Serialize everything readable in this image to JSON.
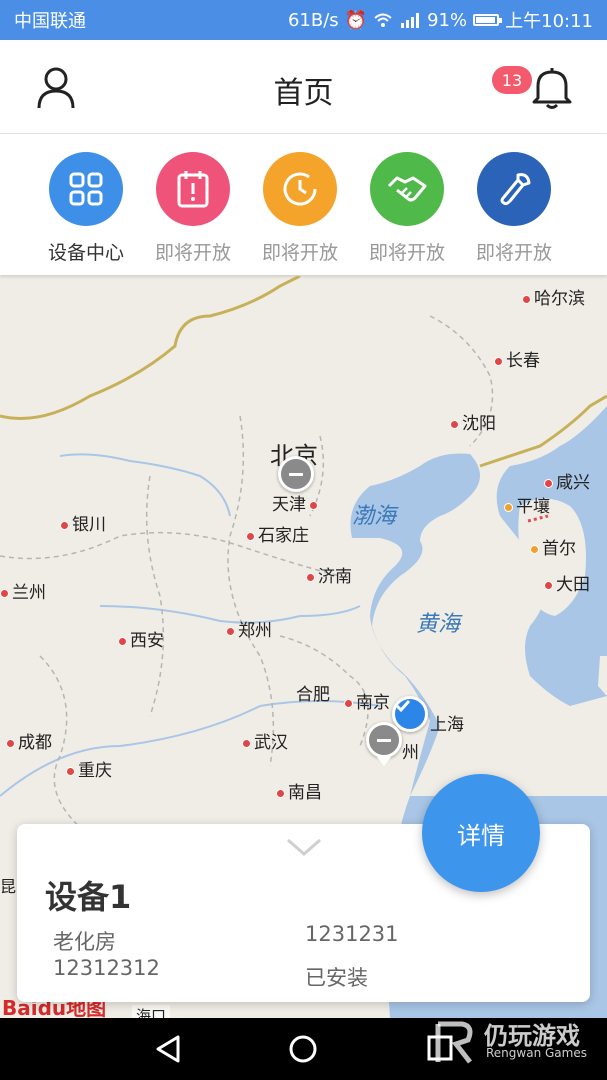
{
  "status_bar": {
    "carrier": "中国联通",
    "net_speed": "61B/s",
    "battery": "91%",
    "time": "上午10:11"
  },
  "header": {
    "title": "首页",
    "notification_count": "13",
    "left_icon": "user-icon",
    "right_icon": "bell-icon"
  },
  "quick_actions": [
    {
      "label": "设备中心",
      "icon": "grid-icon",
      "color": "#3d8fe8",
      "label_color": "#333333"
    },
    {
      "label": "即将开放",
      "icon": "clipboard-alert-icon",
      "color": "#f0537a",
      "label_color": "#999999"
    },
    {
      "label": "即将开放",
      "icon": "clock-icon",
      "color": "#f4a42a",
      "label_color": "#999999"
    },
    {
      "label": "即将开放",
      "icon": "handshake-icon",
      "color": "#4fb94a",
      "label_color": "#999999"
    },
    {
      "label": "即将开放",
      "icon": "wrench-icon",
      "color": "#2a63b8",
      "label_color": "#999999"
    }
  ],
  "map": {
    "cities": {
      "harbin": "哈尔滨",
      "changchun": "长春",
      "shenyang": "沈阳",
      "beijing": "北京",
      "tianjin": "天津",
      "shijiazhuang": "石家庄",
      "jinan": "济南",
      "yinchuan": "银川",
      "lanzhou": "兰州",
      "xian": "西安",
      "zhengzhou": "郑州",
      "hefei": "合肥",
      "nanjing": "南京",
      "shanghai": "上海",
      "hangzhou": "州",
      "chengdu": "成都",
      "chongqing": "重庆",
      "wuhan": "武汉",
      "nanchang": "南昌",
      "xianxing": "咸兴",
      "pyongyang": "平壤",
      "seoul": "首尔",
      "daejeon": "大田",
      "haikou": "海口",
      "kunming": "昆明"
    },
    "seas": {
      "bohai": "渤海",
      "yellow": "黄海"
    },
    "logo": "Baidu地图"
  },
  "device_card": {
    "name": "设备1",
    "type": "老化房",
    "code": "12312312",
    "serial": "1231231",
    "status": "已安装"
  },
  "detail_button": "详情",
  "watermark": {
    "main": "仍玩游戏",
    "sub": "Rengwan Games"
  }
}
